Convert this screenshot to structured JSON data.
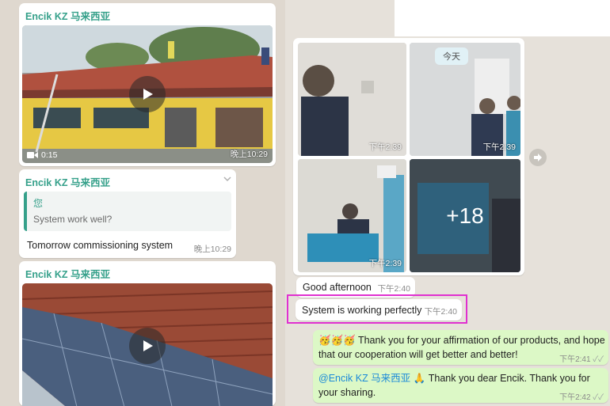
{
  "left_chat": {
    "video_message": {
      "sender": "Encik KZ 马来西亚",
      "duration": "0:15",
      "time": "晚上10:29"
    },
    "reply_message": {
      "sender": "Encik KZ 马来西亚",
      "quoted_author": "您",
      "quoted_text": "System work well?",
      "text": "Tomorrow commissioning system",
      "time": "晚上10:29"
    },
    "video_message_2": {
      "sender": "Encik KZ 马来西亚"
    }
  },
  "right_chat": {
    "date_badge": "今天",
    "photo_grid": {
      "times": [
        "下午2:39",
        "下午2:39",
        "下午2:39"
      ],
      "more_count": "+18"
    },
    "incoming_messages": [
      {
        "text": "Good afternoon",
        "time": "下午2:40"
      },
      {
        "text": "System is working perfectly",
        "time": "下午2:40"
      }
    ],
    "outgoing_messages": [
      {
        "emojis": "🥳🥳🥳",
        "text": "Thank you for your affirmation of our products, and hope that our cooperation will get better and better!",
        "time": "下午2:41",
        "status": "✓✓"
      },
      {
        "mention": "@Encik KZ 马来西亚",
        "emoji": "🙏",
        "text": "Thank you dear Encik. Thank you for your sharing.",
        "time": "下午2:42",
        "status": "✓✓"
      }
    ]
  },
  "colors": {
    "sender_green": "#35a08a",
    "outgoing_bubble": "#dcf8c6",
    "highlight_magenta": "#e030d0",
    "mention_blue": "#1b8ad8"
  },
  "icons": [
    "play-icon",
    "video-camera-icon",
    "forward-icon",
    "double-check-icon",
    "chevron-down-icon"
  ]
}
